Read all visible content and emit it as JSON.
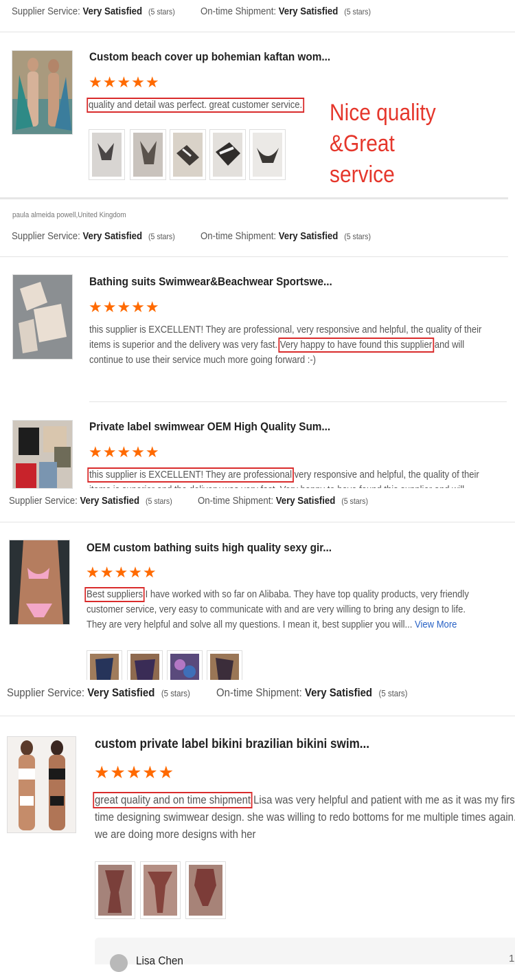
{
  "rating_labels": {
    "supplier_service": "Supplier Service:",
    "on_time": "On-time Shipment:",
    "value": "Very Satisfied",
    "stars_note": "(5 stars)"
  },
  "stars_glyph": "★★★★★",
  "annotation": {
    "line1": "Nice quality &Great",
    "line2": "service"
  },
  "reviewer_2": "paula almeida powell,United Kingdom",
  "reviews": [
    {
      "title": "Custom beach cover up bohemian kaftan wom...",
      "highlight": "quality and detail was perfect. great customer service."
    },
    {
      "title": "Bathing suits Swimwear&Beachwear Sportswe...",
      "text_a": "this supplier is EXCELLENT! They are professional, very responsive and helpful, the quality of their items is superior and the delivery was very fast. ",
      "highlight": "Very happy to have found this supplier",
      "text_b": " and will continue to use their service much more going forward :-)"
    },
    {
      "title": "Private label swimwear OEM High Quality Sum...",
      "highlight": "this supplier is EXCELLENT! They are professional",
      "text_b": " very responsive and helpful, the quality of their items is superior and the delivery was very fast. Very happy to have found this supplier and will continue to use their"
    },
    {
      "title": "OEM custom bathing suits high quality sexy gir...",
      "highlight": "Best suppliers",
      "text_b": " I have worked with so far on Alibaba. They have top quality products, very friendly customer service, very easy to communicate with and are very willing to bring any design to life. They are very helpful and solve all my questions. I mean it, best supplier you will... ",
      "view_more": "View More"
    },
    {
      "title": "custom private label bikini brazilian bikini swim...",
      "highlight": "great quality and on time shipment",
      "text_b": " Lisa was very helpful and patient with me as it was my first time designing swimwear design. she was willing to redo bottoms for me multiple times again. we are doing more designs with her"
    }
  ],
  "reply_author": "Lisa Chen",
  "reply_number": "1"
}
